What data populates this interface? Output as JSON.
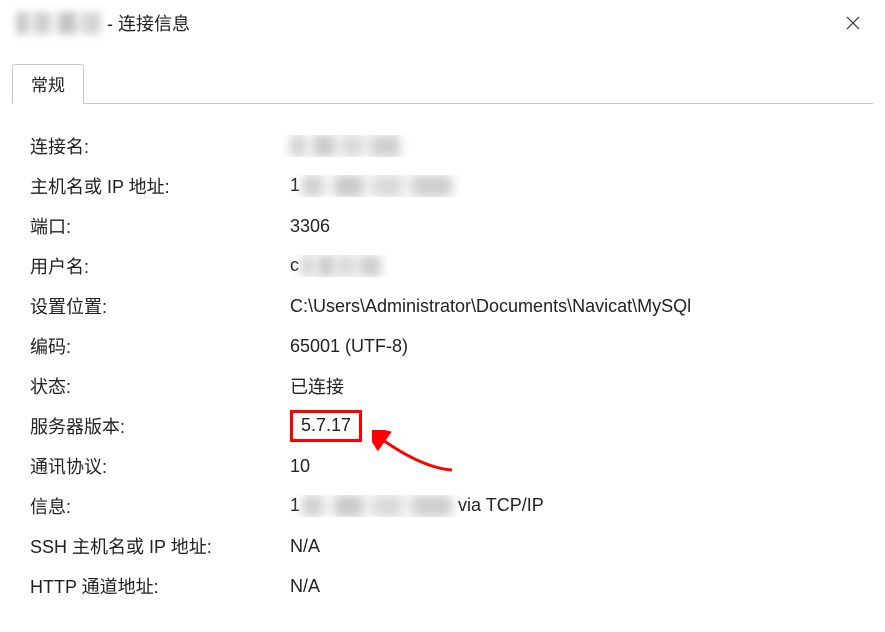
{
  "window": {
    "title_suffix": "- 连接信息"
  },
  "tabs": {
    "general": "常规"
  },
  "rows": {
    "conn_name": {
      "label": "连接名:",
      "redacted": true,
      "blur_w": 110
    },
    "host": {
      "label": "主机名或 IP 地址:",
      "prefix": "1",
      "redacted": true,
      "blur_w": 150
    },
    "port": {
      "label": "端口:",
      "value": "3306"
    },
    "user": {
      "label": "用户名:",
      "prefix": "c",
      "redacted": true,
      "blur_w": 80
    },
    "settings_location": {
      "label": "设置位置:",
      "value": "C:\\Users\\Administrator\\Documents\\Navicat\\MySQl"
    },
    "encoding": {
      "label": "编码:",
      "value": "65001 (UTF-8)"
    },
    "status": {
      "label": "状态:",
      "value": "已连接"
    },
    "server_version": {
      "label": "服务器版本:",
      "value": "5.7.17",
      "highlight": true
    },
    "protocol": {
      "label": "通讯协议:",
      "value": "10"
    },
    "info": {
      "label": "信息:",
      "prefix": "1",
      "redacted": true,
      "blur_w": 150,
      "suffix": "via TCP/IP"
    },
    "ssh_host": {
      "label": "SSH 主机名或 IP 地址:",
      "value": "N/A"
    },
    "http_tunnel": {
      "label": "HTTP 通道地址:",
      "value": "N/A"
    }
  }
}
